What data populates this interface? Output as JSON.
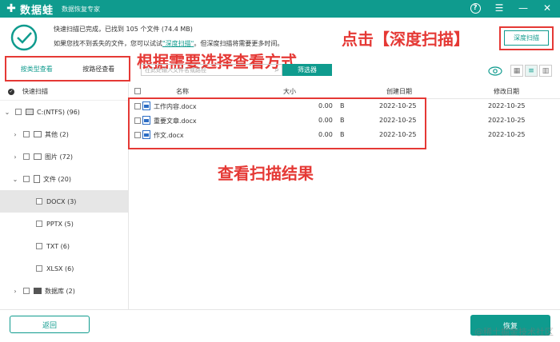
{
  "titlebar": {
    "app_name": "数据蛙",
    "subtitle": "数据恢复专家",
    "help_icon": "help-icon",
    "menu_icon": "menu-icon",
    "minimize_icon": "minimize-icon",
    "close_icon": "close-icon"
  },
  "status": {
    "line1": "快速扫描已完成，已找到 105 个文件 (74.4 MB)",
    "line2_prefix": "如果您找不到丢失的文件，您可以试试",
    "line2_link": "\"深度扫描\"",
    "line2_suffix": "。但深度扫描将需要更多时间。"
  },
  "deep_scan_label": "深度扫描",
  "annotations": {
    "deep": "点击【深度扫描】",
    "choose": "根据需要选择查看方式",
    "result": "查看扫描结果"
  },
  "filter_tabs": [
    "按类型查看",
    "按路径查看"
  ],
  "search": {
    "placeholder": "在此处输入文件名或路径"
  },
  "filter_button": "筛选器",
  "tree": {
    "header": "快速扫描",
    "items": [
      {
        "label": "C:(NTFS) (96)",
        "icon": "disk-icon",
        "chevron": "⌄",
        "indent": 0
      },
      {
        "label": "其他 (2)",
        "icon": "folder-icon",
        "chevron": "›",
        "indent": 1
      },
      {
        "label": "图片 (72)",
        "icon": "image-icon",
        "chevron": "›",
        "indent": 1
      },
      {
        "label": "文件 (20)",
        "icon": "document-icon",
        "chevron": "⌄",
        "indent": 1
      },
      {
        "label": "DOCX (3)",
        "icon": "",
        "chevron": "",
        "indent": 2,
        "selected": true
      },
      {
        "label": "PPTX (5)",
        "icon": "",
        "chevron": "",
        "indent": 2
      },
      {
        "label": "TXT (6)",
        "icon": "",
        "chevron": "",
        "indent": 2
      },
      {
        "label": "XLSX (6)",
        "icon": "",
        "chevron": "",
        "indent": 2
      },
      {
        "label": "数据库 (2)",
        "icon": "database-icon",
        "chevron": "›",
        "indent": 1
      }
    ]
  },
  "table": {
    "headers": {
      "name": "名称",
      "size": "大小",
      "created": "创建日期",
      "modified": "修改日期"
    },
    "rows": [
      {
        "name": "工作内容.docx",
        "size": "0.00",
        "unit": "B",
        "created": "2022-10-25",
        "modified": "2022-10-25"
      },
      {
        "name": "重要文章.docx",
        "size": "0.00",
        "unit": "B",
        "created": "2022-10-25",
        "modified": "2022-10-25"
      },
      {
        "name": "作文.docx",
        "size": "0.00",
        "unit": "B",
        "created": "2022-10-25",
        "modified": "2022-10-25"
      }
    ]
  },
  "bottom": {
    "back": "返回",
    "recover": "恢复",
    "watermark": "@稀土掘金技术社区"
  },
  "colors": {
    "accent": "#0f9b8e",
    "annotation": "#e53935"
  }
}
